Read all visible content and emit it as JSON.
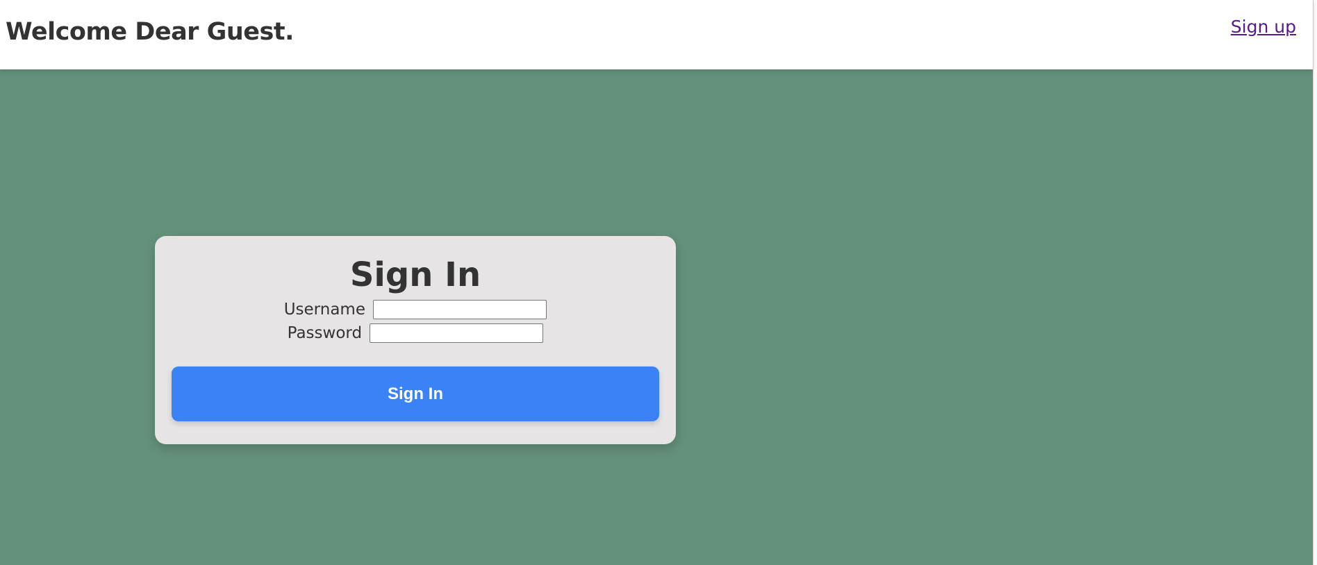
{
  "header": {
    "welcome_text": "Welcome Dear Guest.",
    "signup_link": "Sign up"
  },
  "signin_form": {
    "title": "Sign In",
    "username_label": "Username",
    "username_value": "",
    "password_label": "Password",
    "password_value": "",
    "submit_label": "Sign In"
  },
  "colors": {
    "page_background": "#64917c",
    "card_background": "#e6e4e5",
    "button_background": "#3b82f6",
    "link_color": "#551a8b",
    "text_color": "#333333"
  }
}
